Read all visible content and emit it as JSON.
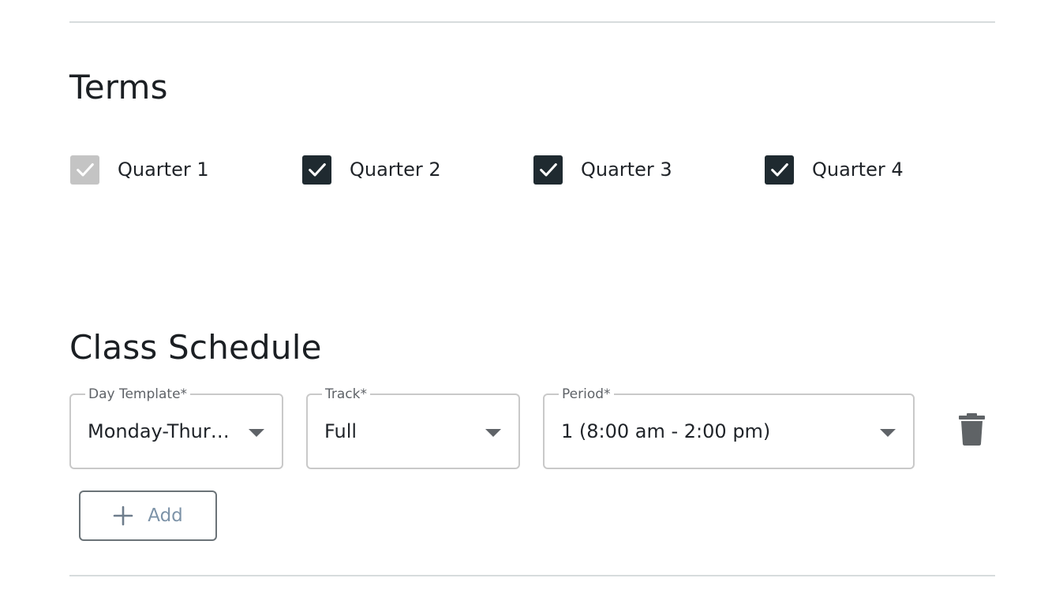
{
  "terms": {
    "title": "Terms",
    "items": [
      {
        "label": "Quarter 1",
        "checked": true,
        "disabled": true
      },
      {
        "label": "Quarter 2",
        "checked": true,
        "disabled": false
      },
      {
        "label": "Quarter 3",
        "checked": true,
        "disabled": false
      },
      {
        "label": "Quarter 4",
        "checked": true,
        "disabled": false
      }
    ]
  },
  "schedule": {
    "title": "Class Schedule",
    "day_template": {
      "label": "Day Template*",
      "value": "Monday-Thur…"
    },
    "track": {
      "label": "Track*",
      "value": "Full"
    },
    "period": {
      "label": "Period*",
      "value": "1 (8:00 am - 2:00 pm)"
    },
    "delete_icon": "trash-icon",
    "add_button": {
      "label": "Add",
      "icon": "plus-icon"
    }
  },
  "colors": {
    "checkbox_checked": "#1f2a30",
    "checkbox_disabled": "#c4c4c4",
    "add_label": "#7d93a8"
  }
}
